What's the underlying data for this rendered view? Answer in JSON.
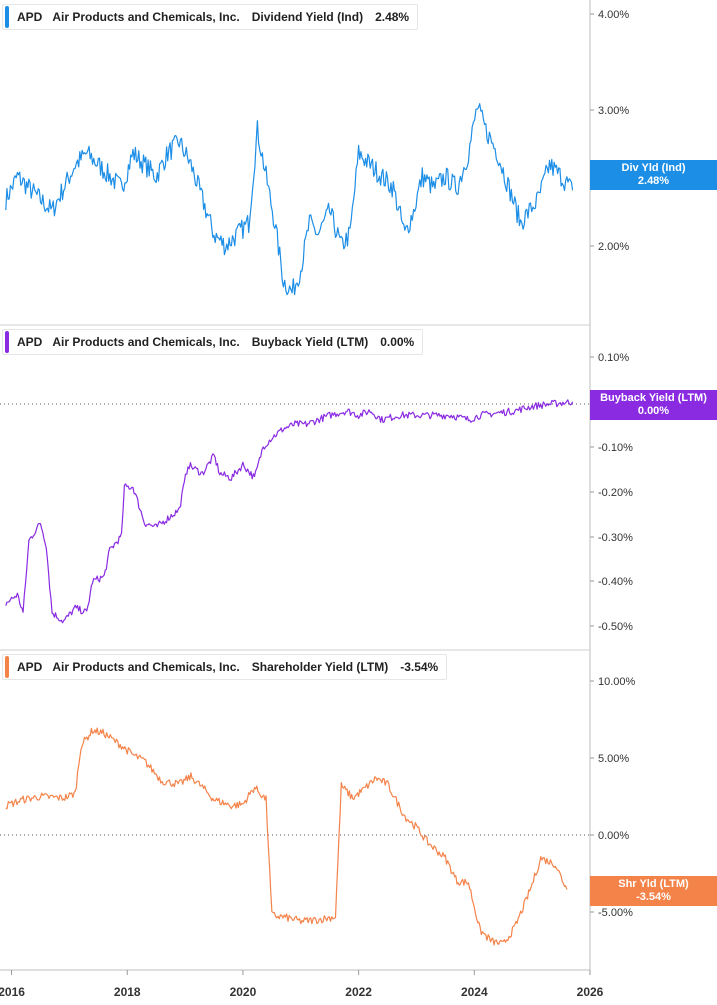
{
  "ticker": "APD",
  "company": "Air Products and Chemicals, Inc.",
  "panels": [
    {
      "metric": "Dividend Yield (Ind)",
      "value_label": "2.48%",
      "color": "#1d8ee6",
      "tag": {
        "line1": "Div Yld (Ind)",
        "line2": "2.48%"
      }
    },
    {
      "metric": "Buyback Yield (LTM)",
      "value_label": "0.00%",
      "color": "#8a2be2",
      "tag": {
        "line1": "Buyback Yield (LTM)",
        "line2": "0.00%"
      }
    },
    {
      "metric": "Shareholder Yield (LTM)",
      "value_label": "-3.54%",
      "color": "#f4834a",
      "tag": {
        "line1": "Shr Yld (LTM)",
        "line2": "-3.54%"
      }
    }
  ],
  "chart_data": [
    {
      "type": "line",
      "series": [
        {
          "name": "Div Yld (Ind)",
          "values": [
            [
              2015.9,
              2.4
            ],
            [
              2016.1,
              2.6
            ],
            [
              2016.3,
              2.5
            ],
            [
              2016.5,
              2.4
            ],
            [
              2016.7,
              2.3
            ],
            [
              2016.9,
              2.5
            ],
            [
              2017.1,
              2.7
            ],
            [
              2017.3,
              2.8
            ],
            [
              2017.5,
              2.7
            ],
            [
              2017.7,
              2.6
            ],
            [
              2017.9,
              2.5
            ],
            [
              2018.1,
              2.8
            ],
            [
              2018.3,
              2.7
            ],
            [
              2018.5,
              2.6
            ],
            [
              2018.7,
              2.8
            ],
            [
              2018.9,
              2.9
            ],
            [
              2019.1,
              2.7
            ],
            [
              2019.3,
              2.4
            ],
            [
              2019.5,
              2.1
            ],
            [
              2019.7,
              2.0
            ],
            [
              2019.9,
              2.1
            ],
            [
              2020.1,
              2.2
            ],
            [
              2020.25,
              3.0
            ],
            [
              2020.4,
              2.6
            ],
            [
              2020.55,
              2.2
            ],
            [
              2020.7,
              1.7
            ],
            [
              2020.85,
              1.6
            ],
            [
              2021.0,
              1.8
            ],
            [
              2021.15,
              2.2
            ],
            [
              2021.3,
              2.1
            ],
            [
              2021.5,
              2.3
            ],
            [
              2021.7,
              2.0
            ],
            [
              2021.85,
              2.1
            ],
            [
              2022.0,
              2.8
            ],
            [
              2022.2,
              2.7
            ],
            [
              2022.4,
              2.6
            ],
            [
              2022.6,
              2.5
            ],
            [
              2022.8,
              2.1
            ],
            [
              2022.95,
              2.3
            ],
            [
              2023.1,
              2.6
            ],
            [
              2023.3,
              2.5
            ],
            [
              2023.5,
              2.6
            ],
            [
              2023.7,
              2.5
            ],
            [
              2023.9,
              2.8
            ],
            [
              2024.05,
              3.2
            ],
            [
              2024.2,
              3.0
            ],
            [
              2024.4,
              2.8
            ],
            [
              2024.6,
              2.5
            ],
            [
              2024.8,
              2.2
            ],
            [
              2024.95,
              2.3
            ],
            [
              2025.1,
              2.4
            ],
            [
              2025.3,
              2.7
            ],
            [
              2025.5,
              2.6
            ],
            [
              2025.7,
              2.48
            ]
          ]
        }
      ],
      "ylim": [
        1.5,
        4.1
      ],
      "yticks": [
        "4.00%",
        "3.00%",
        "2.00%"
      ]
    },
    {
      "type": "line",
      "series": [
        {
          "name": "Buyback Yield (LTM)",
          "values": [
            [
              2015.9,
              -0.45
            ],
            [
              2016.1,
              -0.43
            ],
            [
              2016.2,
              -0.47
            ],
            [
              2016.3,
              -0.31
            ],
            [
              2016.5,
              -0.27
            ],
            [
              2016.6,
              -0.32
            ],
            [
              2016.7,
              -0.47
            ],
            [
              2016.9,
              -0.49
            ],
            [
              2017.1,
              -0.46
            ],
            [
              2017.3,
              -0.47
            ],
            [
              2017.4,
              -0.4
            ],
            [
              2017.6,
              -0.39
            ],
            [
              2017.7,
              -0.33
            ],
            [
              2017.9,
              -0.3
            ],
            [
              2017.95,
              -0.19
            ],
            [
              2018.1,
              -0.19
            ],
            [
              2018.3,
              -0.27
            ],
            [
              2018.5,
              -0.28
            ],
            [
              2018.7,
              -0.26
            ],
            [
              2018.9,
              -0.24
            ],
            [
              2019.05,
              -0.14
            ],
            [
              2019.3,
              -0.16
            ],
            [
              2019.5,
              -0.12
            ],
            [
              2019.6,
              -0.16
            ],
            [
              2019.8,
              -0.17
            ],
            [
              2020.0,
              -0.14
            ],
            [
              2020.2,
              -0.17
            ],
            [
              2020.35,
              -0.1
            ],
            [
              2020.5,
              -0.08
            ],
            [
              2020.7,
              -0.06
            ],
            [
              2020.9,
              -0.05
            ],
            [
              2021.1,
              -0.05
            ],
            [
              2021.3,
              -0.04
            ],
            [
              2021.5,
              -0.03
            ],
            [
              2021.8,
              -0.02
            ],
            [
              2022.0,
              -0.03
            ],
            [
              2022.2,
              -0.02
            ],
            [
              2022.4,
              -0.04
            ],
            [
              2022.7,
              -0.03
            ],
            [
              2023.0,
              -0.03
            ],
            [
              2023.3,
              -0.03
            ],
            [
              2023.6,
              -0.03
            ],
            [
              2023.9,
              -0.04
            ],
            [
              2024.1,
              -0.03
            ],
            [
              2024.4,
              -0.025
            ],
            [
              2024.7,
              -0.02
            ],
            [
              2025.0,
              -0.01
            ],
            [
              2025.3,
              -0.005
            ],
            [
              2025.7,
              0.0
            ]
          ]
        }
      ],
      "ylim": [
        -0.55,
        0.14
      ],
      "yticks": [
        "0.10%",
        "-0.10%",
        "-0.20%",
        "-0.30%",
        "-0.40%",
        "-0.50%"
      ]
    },
    {
      "type": "line",
      "series": [
        {
          "name": "Shr Yld (LTM)",
          "values": [
            [
              2015.9,
              1.9
            ],
            [
              2016.2,
              2.3
            ],
            [
              2016.5,
              2.5
            ],
            [
              2016.9,
              2.4
            ],
            [
              2017.1,
              2.7
            ],
            [
              2017.2,
              5.8
            ],
            [
              2017.4,
              6.8
            ],
            [
              2017.6,
              6.6
            ],
            [
              2017.9,
              5.8
            ],
            [
              2018.1,
              5.2
            ],
            [
              2018.3,
              4.8
            ],
            [
              2018.6,
              3.5
            ],
            [
              2018.9,
              3.3
            ],
            [
              2019.1,
              3.8
            ],
            [
              2019.3,
              3.1
            ],
            [
              2019.5,
              2.3
            ],
            [
              2019.8,
              1.9
            ],
            [
              2020.0,
              2.0
            ],
            [
              2020.2,
              3.1
            ],
            [
              2020.4,
              2.3
            ],
            [
              2020.5,
              -5.2
            ],
            [
              2020.8,
              -5.4
            ],
            [
              2021.0,
              -5.6
            ],
            [
              2021.3,
              -5.5
            ],
            [
              2021.6,
              -5.3
            ],
            [
              2021.7,
              3.2
            ],
            [
              2021.9,
              2.4
            ],
            [
              2022.1,
              3.0
            ],
            [
              2022.3,
              3.7
            ],
            [
              2022.5,
              3.3
            ],
            [
              2022.8,
              1.2
            ],
            [
              2023.0,
              0.5
            ],
            [
              2023.2,
              -0.5
            ],
            [
              2023.5,
              -1.5
            ],
            [
              2023.7,
              -3.0
            ],
            [
              2023.9,
              -3.1
            ],
            [
              2024.1,
              -6.2
            ],
            [
              2024.3,
              -6.9
            ],
            [
              2024.5,
              -7.1
            ],
            [
              2024.7,
              -6.0
            ],
            [
              2024.9,
              -4.2
            ],
            [
              2025.0,
              -3.2
            ],
            [
              2025.15,
              -1.5
            ],
            [
              2025.4,
              -1.9
            ],
            [
              2025.6,
              -3.54
            ]
          ]
        }
      ],
      "ylim": [
        -8.0,
        10.5
      ],
      "yticks": [
        "10.00%",
        "5.00%",
        "0.00%",
        "-5.00%"
      ]
    }
  ],
  "x_axis": {
    "labels": [
      "2016",
      "2018",
      "2020",
      "2022",
      "2024",
      "2026"
    ],
    "range": [
      2015.8,
      2026.0
    ]
  }
}
